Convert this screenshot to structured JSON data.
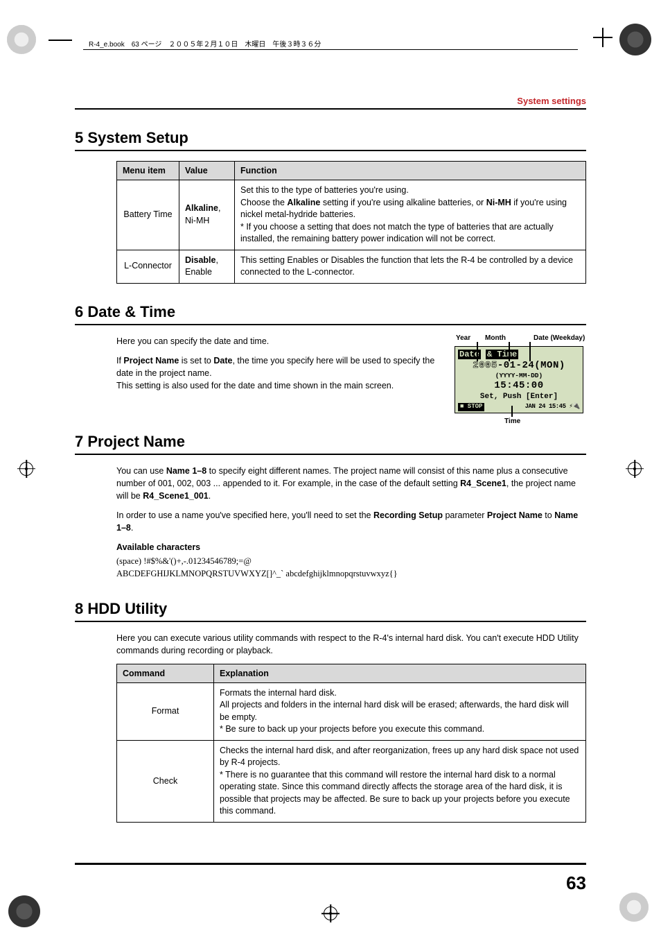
{
  "print_header": "R-4_e.book　63 ページ　２００５年２月１０日　木曜日　午後３時３６分",
  "section_header": "System settings",
  "page_number": "63",
  "sec5": {
    "title": "5 System Setup",
    "headers": [
      "Menu item",
      "Value",
      "Function"
    ],
    "rows": [
      {
        "menu": "Battery Time",
        "value_html": "<b>Alkaline</b>,<br>Ni-MH",
        "func_html": "Set this to the type of batteries you're using.<br>Choose the <b>Alkaline</b> setting if you're using alkaline batteries, or <b>Ni-MH</b> if you're using nickel metal-hydride batteries.<br>* If you choose a setting that does not match the type of batteries that are actually installed, the remaining battery power indication will not be correct."
      },
      {
        "menu": "L-Connector",
        "value_html": "<b>Disable</b>,<br>Enable",
        "func_html": "This setting Enables or Disables the function that lets the R-4 be controlled by a device connected to the L-connector."
      }
    ]
  },
  "sec6": {
    "title": "6 Date & Time",
    "p1": "Here you can specify the date and time.",
    "p2_html": "If <b>Project Name</b> is set to <b>Date</b>, the time you specify here will be used to specify the date in the project name.<br>This setting is also used for the date and time shown in the main screen.",
    "labels": {
      "year": "Year",
      "month": "Month",
      "date_weekday": "Date (Weekday)",
      "time": "Time"
    },
    "lcd": {
      "title_inv1": "Date",
      "title_inv2": "& Time",
      "date_line_outline": "2005",
      "date_line_rest": "-01-24(MON)",
      "date_fmt": "(YYYY-MM-DD)",
      "time": "15:45:00",
      "hint": "Set, Push [Enter]",
      "status_left": "■ STOP",
      "status_right": "JAN 24 15:45 ⚡🔌"
    }
  },
  "sec7": {
    "title": "7 Project Name",
    "p1_html": "You can use <b>Name 1–8</b> to specify eight different names. The project name will consist of this name plus a consecutive number of 001, 002, 003 ... appended to it. For example, in the case of the default setting <b>R4_Scene1</b>, the project name will be <b>R4_Scene1_001</b>.",
    "p2_html": "In order to use a name you've specified here, you'll need to set the <b>Recording Setup</b> parameter <b>Project Name</b> to <b>Name 1–8</b>.",
    "subhead": "Available characters",
    "chars1": " (space) !#$%&'()+,-.01234546789;=@",
    "chars2": "ABCDEFGHIJKLMNOPQRSTUVWXYZ[]^_` abcdefghijklmnopqrstuvwxyz{}"
  },
  "sec8": {
    "title": "8 HDD Utility",
    "intro": "Here you can execute various utility commands with respect to the R-4's internal hard disk. You can't execute HDD Utility commands during recording or playback.",
    "headers": [
      "Command",
      "Explanation"
    ],
    "rows": [
      {
        "cmd": "Format",
        "exp_html": "Formats the internal hard disk.<br>All projects and folders in the internal hard disk will be erased; afterwards, the hard disk will be empty.<br>* Be sure to back up your projects before you execute this command."
      },
      {
        "cmd": "Check",
        "exp_html": "Checks the internal hard disk, and after reorganization, frees up any hard disk space not used by R-4 projects.<br>* There is no guarantee that this command will restore the internal hard disk to a normal operating state. Since this command directly affects the storage area of the hard disk, it is possible that projects may be affected. Be sure to back up your projects before you execute this command."
      }
    ]
  }
}
